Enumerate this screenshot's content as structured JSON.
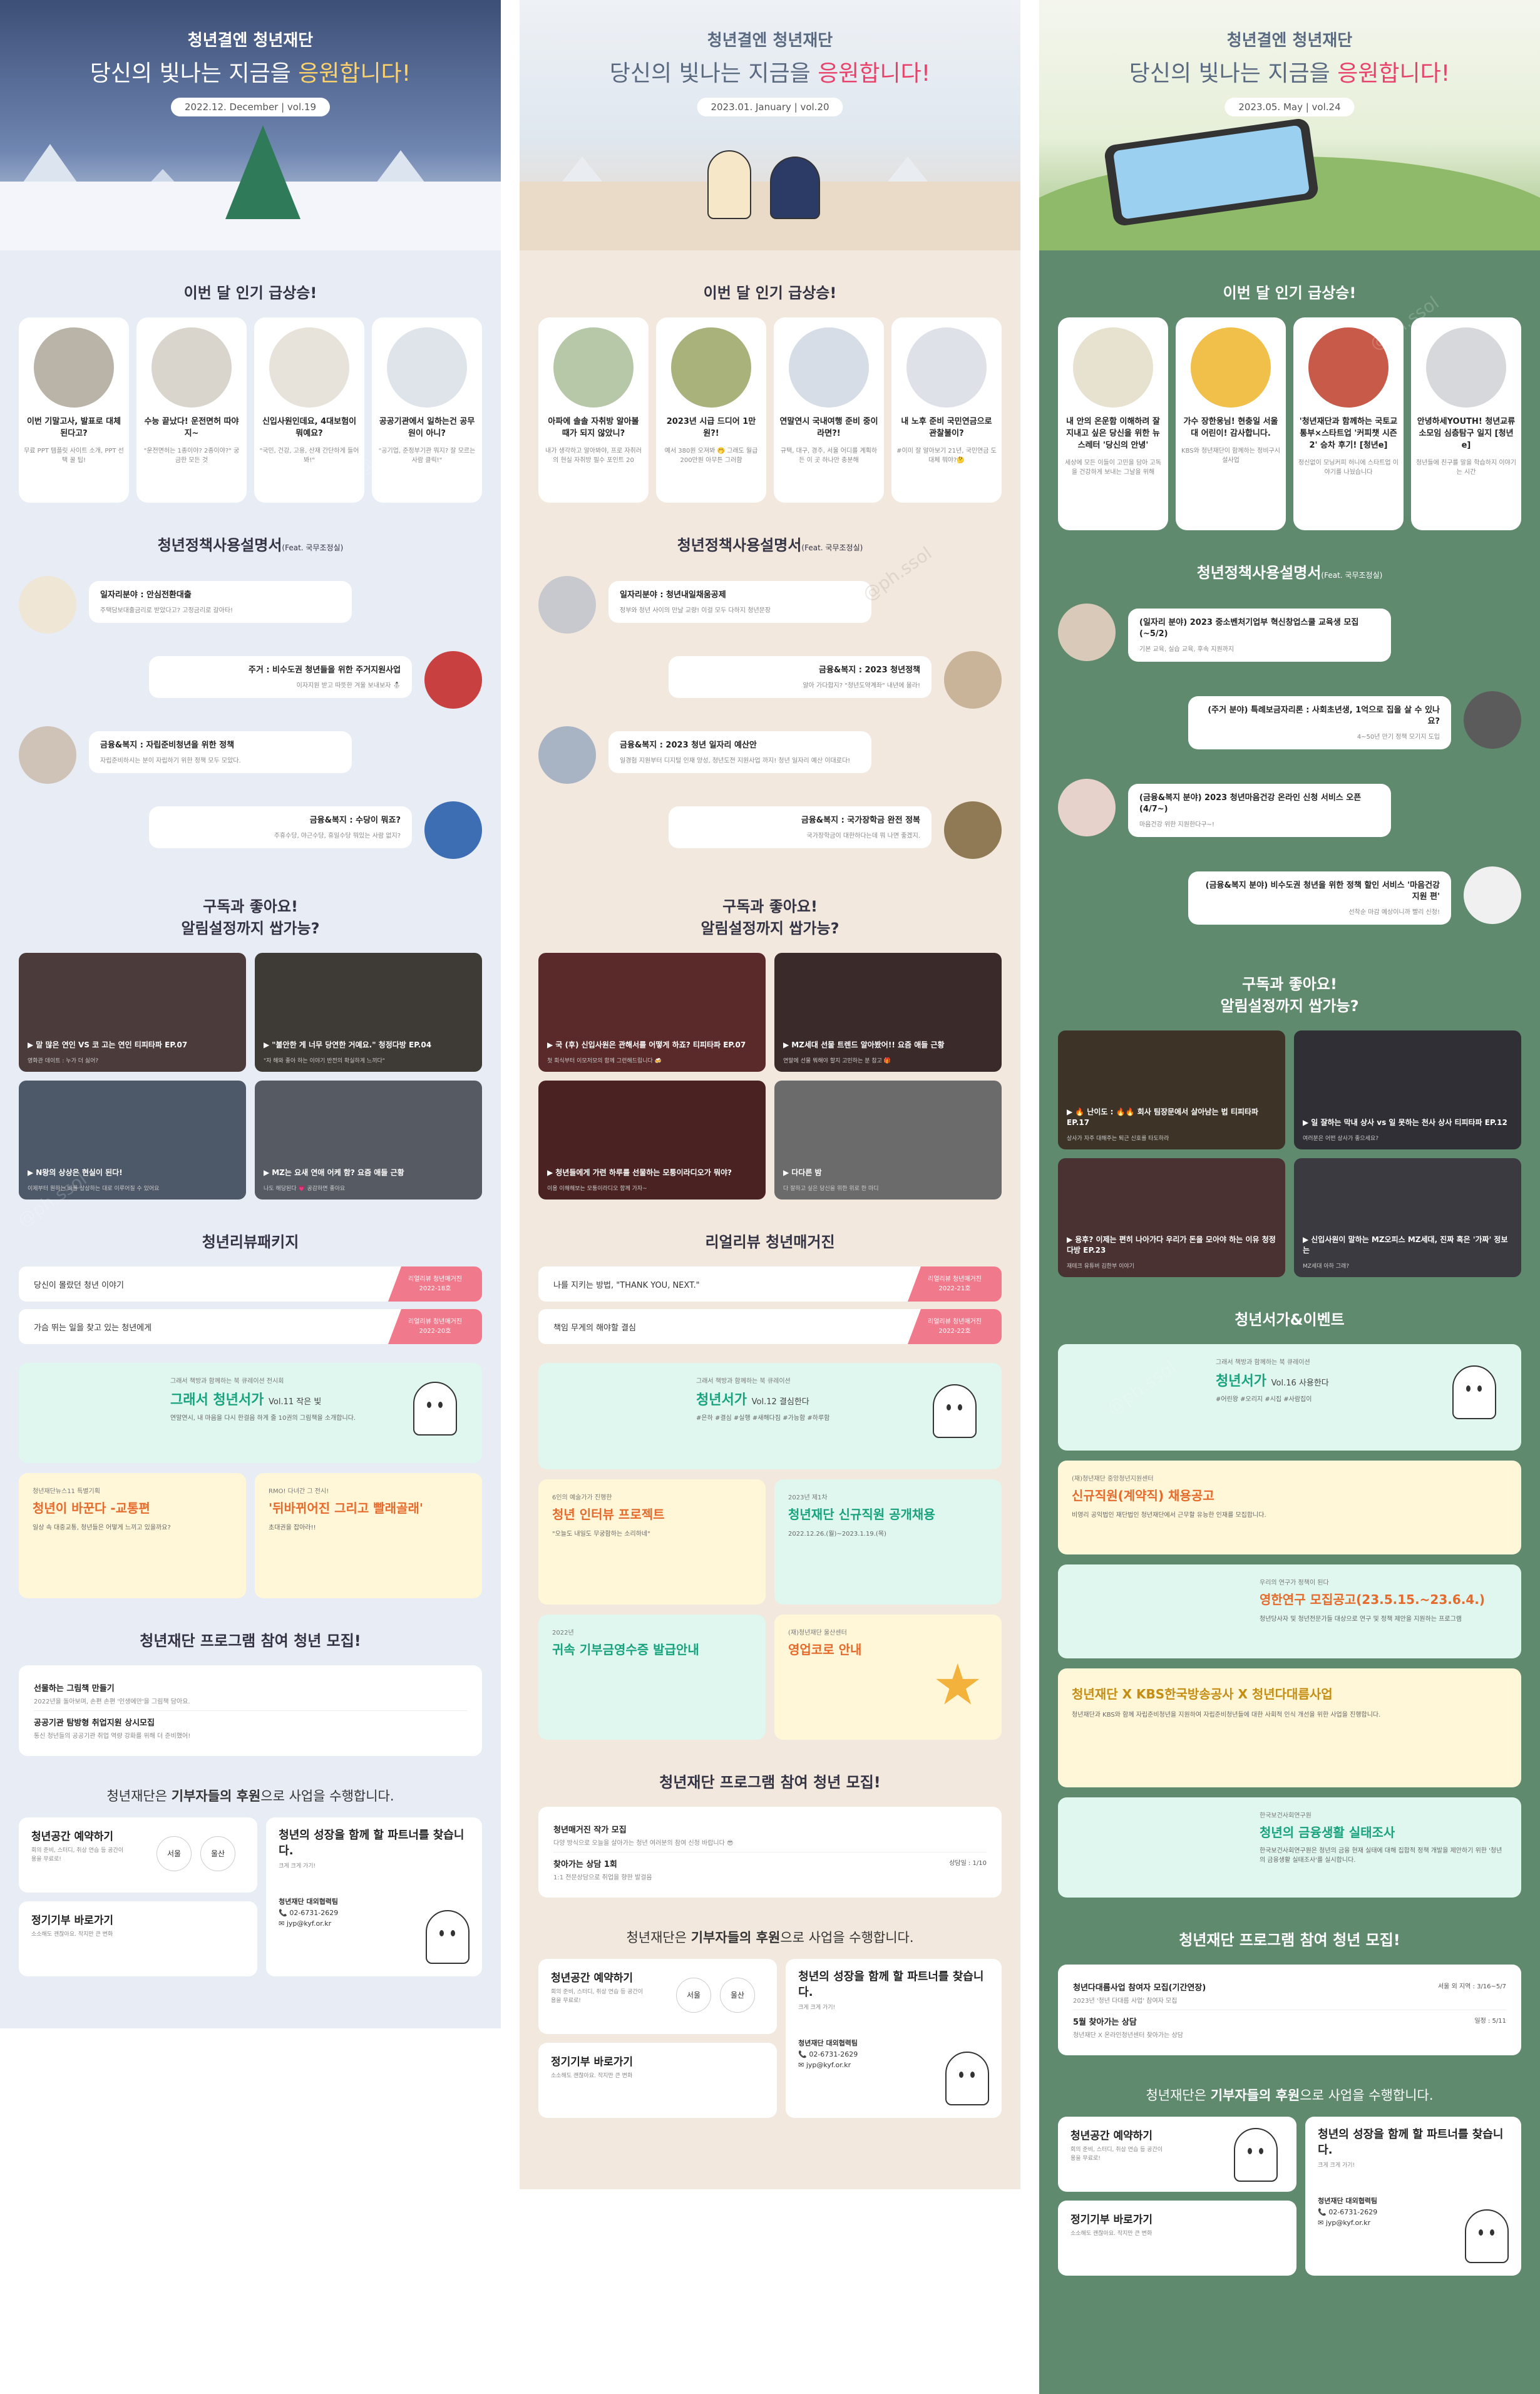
{
  "columns": [
    {
      "hero": {
        "sub_a": "청년",
        "sub_b": "결엔",
        "sub_c": "청년재단",
        "title_a": "당신의 빛나는 지금을 ",
        "title_hl": "응원합니다!",
        "date": "2022.12. December  |  vol.19"
      },
      "popular_title": "이번 달 인기 급상승!",
      "popular": [
        {
          "title": "이번 기말고사, 발표로 대체된다고?",
          "desc": "무료 PPT 템플릿 사이트 소개, PPT 선택 꿀 팁!"
        },
        {
          "title": "수능 끝났다! 운전면허 따야지~",
          "desc": "\"운전면허는 1종이야? 2종이야?\" 궁금한 모든 것"
        },
        {
          "title": "신입사원인데요, 4대보험이 뭐예요?",
          "desc": "\"국민, 건강, 고용, 산재 간단하게 들어봐!\""
        },
        {
          "title": "공공기관에서 일하는건 공무원이 아니?",
          "desc": "\"공기업, 준정부기관 뭐지? 잘 모르는 사람 클릭!\""
        }
      ],
      "policy_title": "청년정책사용설명서",
      "policy_feat": "(Feat. 국무조정실)",
      "policy": [
        {
          "side": "l",
          "title": "일자리분야 : 안심전환대출",
          "desc": "주택담보대출금리로 받았다고? 고정금리로 갈아타!"
        },
        {
          "side": "r",
          "title": "주거 : 비수도권 청년들을 위한 주거지원사업",
          "desc": "이자지원 받고 따뜻한 겨울 보내보자 ⛄"
        },
        {
          "side": "l",
          "title": "금융&복지 : 자립준비청년을 위한 정책",
          "desc": "자립준비하시는 분이 자립하기 위한 정책 모두 모았다."
        },
        {
          "side": "r",
          "title": "금융&복지 : 수당이 뭐죠?",
          "desc": "주휴수당, 야근수당, 휴일수당 뭐있는 사람 없지?"
        }
      ],
      "sub_title_a": "구독과 좋아요!",
      "sub_title_b": "알림설정까지 쌉가능?",
      "videos": [
        {
          "title": "말 많은 연인 VS 코 고는 연인 티피타파 EP.07",
          "desc": "영화관 데이트 : 누가 더 싫어?"
        },
        {
          "title": "\"불안한 게 너무 당연한 거예요.\" 청정다방 EP.04",
          "desc": "\"자 해와 좋아 하는 이야기 반전의 확실하게 느끼다\""
        },
        {
          "title": "N왕의 상상은 현실이 된다!",
          "desc": "이제부터 원하는 바를 상상하는 대로 이루어질 수 있어요"
        },
        {
          "title": "MZ는 요새 연애 어케 함? 요즘 애들 근황",
          "desc": "나도 해당된다 💗 공감하면 좋아요"
        }
      ],
      "review_title": "청년리뷰패키지",
      "reviews": [
        {
          "text": "당신이 몰랐던 청년 이야기",
          "badge_a": "리얼리뷰 청년매거진",
          "badge_b": "2022-18호"
        },
        {
          "text": "가슴 뛰는 일을 찾고 있는 청년에게",
          "badge_a": "리얼리뷰 청년매거진",
          "badge_b": "2022-20호"
        }
      ],
      "book": {
        "sub": "그래서 책방과 함께하는 북 큐레이션 전시회",
        "title": "그래서 청년서가",
        "vol": "Vol.11 작은 빛",
        "desc": "연말연시, 내 마음을 다시 한걸음 하게 줄 10권의 그림책을 소개합니다."
      },
      "pair": [
        {
          "pre": "청년재단뉴스11 특별기획",
          "title": "청년이 바꾼다 -교통편",
          "desc": "일상 속 대중교통, 청년들은 어떻게 느끼고 있을까요?"
        },
        {
          "pre": "RMO! 다녀간 그 전시!",
          "title": "'뒤바뀌어진 그리고 빨래골래'",
          "desc": "초대권을 잡아라!!"
        }
      ],
      "prog_title": "청년재단 프로그램 참여 청년 모집!",
      "prog": [
        {
          "title": "선물하는 그림책 만들기",
          "desc": "2022년을 돌아보며, 손편 손편 '인생에만'을 그림책 담아요.",
          "right": ""
        },
        {
          "title": "공공기관 탐방형 취업지원 상시모집",
          "desc": "통신 청년들의 공공기관 취업 역량 강화를 위해 더 준비했어!",
          "right": ""
        }
      ],
      "sponsor": {
        "h_a": "청년재단은 ",
        "h_b": "기부자들의 후원",
        "h_c": "으로 사업을 수행합니다.",
        "space": "청년공간 예약하기",
        "space_d": "회의 준비, 스터디, 취상 연습 등 공간이용을 무료로!",
        "seoul": "서울",
        "ulsan": "울산",
        "partner": "청년의 성장을 함께 할 파트너를 찾습니다.",
        "partner_d": "크게 크게 가기!",
        "donate": "정기기부 바로가기",
        "donate_d": "소소해도 괜찮아요. 작지만 큰 변화",
        "contact_t": "청년재단 대외협력팀",
        "phone": "📞 02-6731-2629",
        "mail": "✉ jyp@kyf.or.kr"
      }
    },
    {
      "hero": {
        "sub_a": "청년",
        "sub_b": "결엔",
        "sub_c": "청년재단",
        "title_a": "당신의 빛나는 지금을 ",
        "title_hl": "응원합니다!",
        "date": "2023.01. January  |  vol.20"
      },
      "popular_title": "이번 달 인기 급상승!",
      "popular": [
        {
          "title": "아파에 솔솔 자취방 알아볼 때가 되지 않았니?",
          "desc": "내가 생각하고 알아봐야, 프로 자취러의 현실 자취방 필수 포인트 20"
        },
        {
          "title": "2023년 시급 드디어 1만원?!",
          "desc": "예서 380원 오져봐 🤭 그래도 월급 200만원 아무튼 그러함"
        },
        {
          "title": "연말연시 국내여행 준비 중이라면?!",
          "desc": "규택, 대구, 경주, 서울 어디를 계획하든 이 곳 하나만 충분해"
        },
        {
          "title": "내 노후 준비 국민연금으로 관찰불이?",
          "desc": "#이미 잘 알아보기 21년, 국민연금 도대체 뭐야?🤔"
        }
      ],
      "policy_title": "청년정책사용설명서",
      "policy_feat": "(Feat. 국무조정실)",
      "policy": [
        {
          "side": "l",
          "title": "일자리분야 : 청년내일채움공제",
          "desc": "정부와 청년 사이의 만날 교량! 이걸 모두 다하지 청년문장"
        },
        {
          "side": "r",
          "title": "금융&복지 : 2023 청년정책",
          "desc": "알아 가다합지? \"청년도약계좌\" 내년에 몰라!"
        },
        {
          "side": "l",
          "title": "금융&복지 : 2023 청년 일자리 예산안",
          "desc": "일경험 지원부터 디지털 인재 양성, 청년도전 지원사업 까지! 청년 일자리 예산 이대로다!"
        },
        {
          "side": "r",
          "title": "금융&복지 : 국가장학금 완전 정복",
          "desc": "국가장학금이 대한하다는데 뭐 나면 좋겠지."
        }
      ],
      "sub_title_a": "구독과 좋아요!",
      "sub_title_b": "알림설정까지 쌉가능?",
      "videos": [
        {
          "title": "국 (후) 신입사원은 관해서를 어떻게 하죠? 티피타파 EP.07",
          "desc": "첫 회식부터 이모저모의 함께 그런해드립니다 🍻"
        },
        {
          "title": "MZ세대 선물 트렌드 알아봤어!! 요즘 애들 근황",
          "desc": "연말에 선물 뭐해야 할지 고민하는 분 참고 🎁"
        },
        {
          "title": "청년들에게 가련 하루를 선물하는 모퉁이라디오가 뭐야?",
          "desc": "이용 이해해보는 모퉁이라디오 함께 가자~"
        },
        {
          "title": "다다른 밤",
          "desc": "다 잘하고 싶은 당신을 위한 위로 한 마디"
        }
      ],
      "review_title": "리얼리뷰 청년매거진",
      "reviews": [
        {
          "text": "나를 지키는 방법, \"THANK YOU, NEXT.\"",
          "badge_a": "리얼리뷰 청년매거진",
          "badge_b": "2022-21호"
        },
        {
          "text": "책임 무게의 해야할 결심",
          "badge_a": "리얼리뷰 청년매거진",
          "badge_b": "2022-22호"
        }
      ],
      "book": {
        "sub": "그래서 책방과 함께하는 북 큐레이션",
        "title": "청년서가",
        "vol": "Vol.12 결심한다",
        "desc": "#은하 #결심 #실행 #새해다짐 #가능함 #하루함"
      },
      "pair": [
        {
          "pre": "6인의 예술가가 진행한",
          "title": "청년 인터뷰 프로젝트",
          "desc": "\"오늘도 내일도 무궁함하는 소리하네\""
        },
        {
          "pre": "2023년 제1차",
          "title": "청년재단 신규직원 공개채용",
          "desc": "2022.12.26.(월)~2023.1.19.(목)"
        },
        {
          "pre": "2022년",
          "title": "귀속 기부금영수증 발급안내",
          "desc": ""
        },
        {
          "pre": "(재)청년재단 울산센터",
          "title": "영업코로 안내",
          "desc": ""
        }
      ],
      "prog_title": "청년재단 프로그램 참여 청년 모집!",
      "prog": [
        {
          "title": "청년매거진 작가 모집",
          "desc": "다양 방식으로 오늘을 살아가는 청년 여러분의 참여 신청 바랍니다 😎",
          "right": ""
        },
        {
          "title": "찾아가는 상담 1회",
          "desc": "1:1 전문상담으로 취업을 향한 발걸음",
          "right": "상담일 : 1/10"
        }
      ],
      "sponsor": {
        "h_a": "청년재단은 ",
        "h_b": "기부자들의 후원",
        "h_c": "으로 사업을 수행합니다.",
        "space": "청년공간 예약하기",
        "space_d": "회의 준비, 스터디, 취상 연습 등 공간이용을 무료로!",
        "seoul": "서울",
        "ulsan": "울산",
        "partner": "청년의 성장을 함께 할 파트너를 찾습니다.",
        "partner_d": "크게 크게 가기!",
        "donate": "정기기부 바로가기",
        "donate_d": "소소해도 괜찮아요. 작지만 큰 변화",
        "contact_t": "청년재단 대외협력팀",
        "phone": "📞 02-6731-2629",
        "mail": "✉ jyp@kyf.or.kr"
      }
    },
    {
      "hero": {
        "sub_a": "청년",
        "sub_b": "결엔",
        "sub_c": "청년재단",
        "title_a": "당신의 빛나는 지금을 ",
        "title_hl": "응원합니다!",
        "date": "2023.05. May  |  vol.24"
      },
      "popular_title": "이번 달 인기 급상승!",
      "popular": [
        {
          "title": "내 안의 온운함 이해하려 잘 지내고 싶은 당신을 위한 뉴스레터 '당신의 안녕'",
          "desc": "세상에 모든 이들이 고민을 담아 고독을 건강하게 보내는 그날을 위해"
        },
        {
          "title": "가수 장한웅님! 현충일 서울대 어린이! 감사합니다.",
          "desc": "KBS와 청년재단이 함께하는 정비구시설사업"
        },
        {
          "title": "'청년재단과 함께하는 국토교통부×스타트업 '커피챗 시즌2' 승차 후기! [청년e]",
          "desc": "정신없이 모닝커피 허니에 스타트업 이야기를 나눴습니다"
        },
        {
          "title": "안녕하세YOUTH! 청년교류 소모임 심층탐구 일지 [청년e]",
          "desc": "청년들에 친구를 말을 학습하지 이야기는 시간"
        }
      ],
      "policy_title": "청년정책사용설명서",
      "policy_feat": "(Feat. 국무조정실)",
      "policy": [
        {
          "side": "l",
          "title": "(일자리 분야) 2023 중소벤처기업부 혁신창업스쿨 교육생 모집(~5/2)",
          "desc": "기본 교육, 실습 교육, 후속 지원까지"
        },
        {
          "side": "r",
          "title": "(주거 분야) 특례보금자리론 : 사회초년생, 1억으로 집을 살 수 있나요?",
          "desc": "4~50년 만기 정책 모기지 도입"
        },
        {
          "side": "l",
          "title": "(금융&복지 분야) 2023 청년마음건강 온라인 신청 서비스 오픈(4/7~)",
          "desc": "마음건강 위한 지원한다구~!"
        },
        {
          "side": "r",
          "title": "(금융&복지 분야) 비수도권 청년을 위한 정책 할인 서비스 '마음건강 지원 편'",
          "desc": "선착순 마감 예상이니까 빨리 신청!"
        }
      ],
      "sub_title_a": "구독과 좋아요!",
      "sub_title_b": "알림설정까지 쌉가능?",
      "videos": [
        {
          "title": "🔥 난이도 : 🔥🔥 회사 팀장문에서 살아남는 법 티피타파 EP.17",
          "desc": "상사가 자주 대해주는 퇴근 신호를 타도하라"
        },
        {
          "title": "일 잘하는 막내 상사 vs 일 못하는 천사 상사 티피타파 EP.12",
          "desc": "여러분은 어떤 상사가 좋으세요?"
        },
        {
          "title": "용후? 이제는 편히 나아가다 우리가 돈을 모아야 하는 이유 청정다방 EP.23",
          "desc": "재테크 유튜버 김한부 이야기"
        },
        {
          "title": "신입사원이 말하는 MZ오피스 MZ세대, 진짜 혹은 '가짜' 정보는",
          "desc": "MZ세대 아하 그래?"
        }
      ],
      "review_title": "청년서가&이벤트",
      "reviews": [],
      "book": {
        "sub": "그래서 책방과 함께하는 북 큐레이션",
        "title": "청년서가",
        "vol": "Vol.16 사용한다",
        "desc": "#어린왕 #오리지 #시집 #사람집이"
      },
      "pair": [
        {
          "pre": "(재)청년재단 중앙청년지원센터",
          "title": "신규직원(계약직) 채용공고",
          "desc": "비영리 공익법인 재단법인 청년재단에서 근무할 유능한 인재를 모집합니다."
        },
        {
          "pre": "우리의 연구가 정책이 된다",
          "title": "영한연구 모집공고(23.5.15.~23.6.4.)",
          "desc": "청년당사자 및 청년전문가들 대상으로 연구 및 정책 제안을 지원하는 프로그램"
        },
        {
          "pre": "",
          "title": "청년재단 X KBS한국방송공사 X 청년다대름사업",
          "desc": "청년재단과 KBS와 함께 자립준비청년을 지원하여 자립준비청년들에 대한 사회적 인식 개선을 위한 사업을 진행합니다."
        },
        {
          "pre": "한국보건사회연구원",
          "title": "청년의 금융생활 실태조사",
          "desc": "한국보건사회연구원은 청년의 금융 현재 실태에 대해 집합적 정책 개발을 제안하기 위한 '청년의 금융생활 실태조사'를 실시합니다."
        }
      ],
      "prog_title": "청년재단 프로그램 참여 청년 모집!",
      "prog": [
        {
          "title": "청년다대름사업 참여자 모집(기간연장)",
          "desc": "2023년 '청년 다대름 사업' 참여자 모집",
          "right": "서울 외 지역 : 3/16~5/7"
        },
        {
          "title": "5월 찾아가는 상담",
          "desc": "청년재단 X 온라인청년센터 찾아가는 상담",
          "right": "일정 : 5/11"
        }
      ],
      "sponsor": {
        "h_a": "청년재단은 ",
        "h_b": "기부자들의 후원",
        "h_c": "으로 사업을 수행합니다.",
        "space": "청년공간 예약하기",
        "space_d": "회의 준비, 스터디, 취상 연습 등 공간이용을 무료로!",
        "seoul": "",
        "ulsan": "",
        "partner": "청년의 성장을 함께 할 파트너를 찾습니다.",
        "partner_d": "크게 크게 가기!",
        "donate": "정기기부 바로가기",
        "donate_d": "소소해도 괜찮아요. 작지만 큰 변화",
        "contact_t": "청년재단 대외협력팀",
        "phone": "📞 02-6731-2629",
        "mail": "✉ jyp@kyf.or.kr"
      }
    }
  ],
  "watermark": "@ph.ssol",
  "colors": {
    "accent": "#e8416a",
    "mint": "#18a37e",
    "orange": "#e56a2c",
    "badge": "#f07a8c"
  }
}
